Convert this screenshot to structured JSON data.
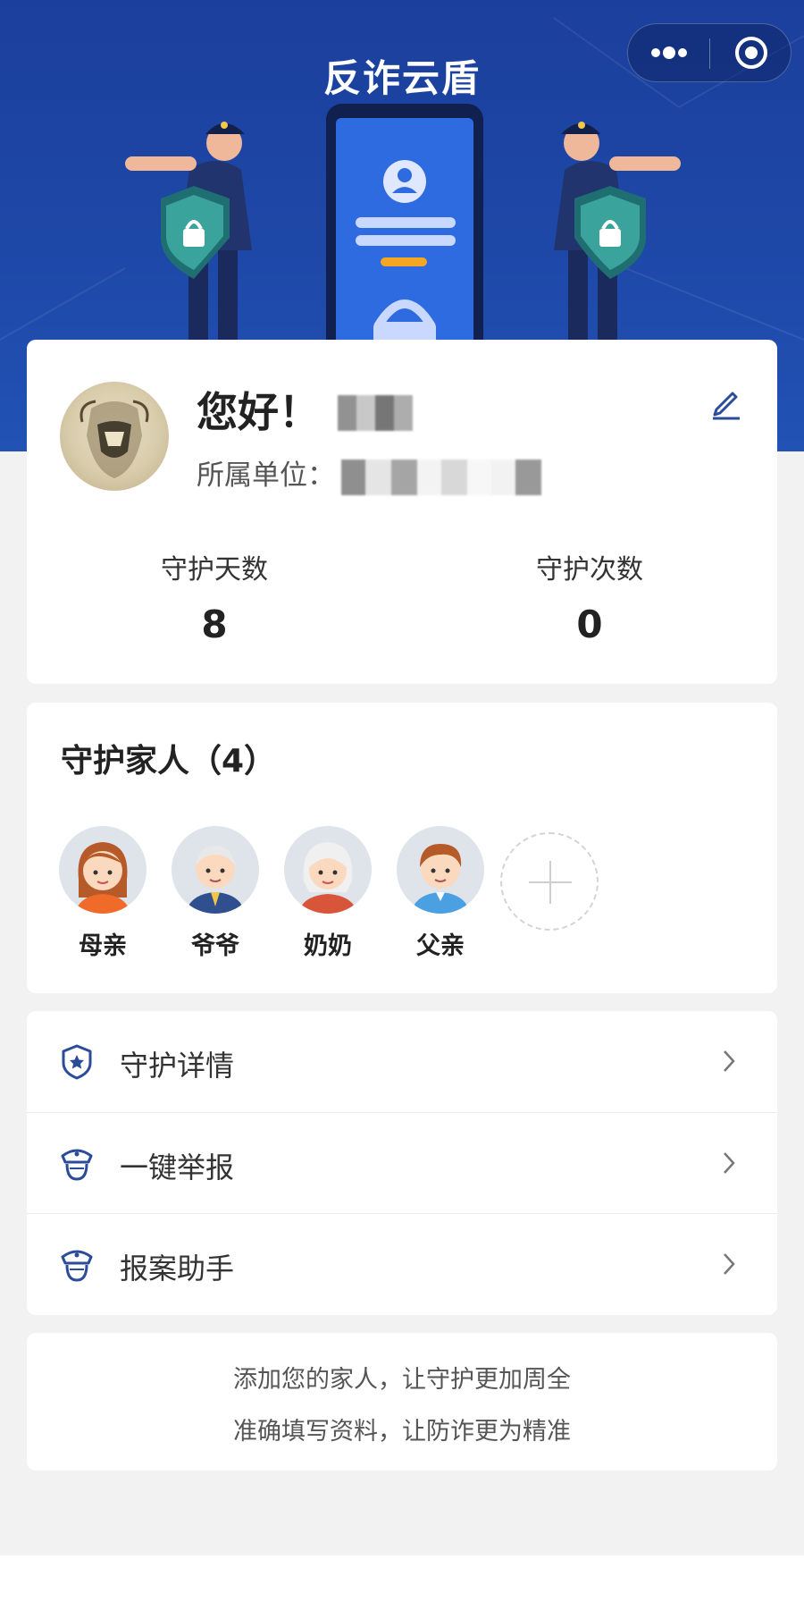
{
  "hero": {
    "title": "反诈云盾"
  },
  "profile": {
    "greeting": "您好！",
    "unit_label": "所属单位：",
    "stats": [
      {
        "label": "守护天数",
        "value": "8"
      },
      {
        "label": "守护次数",
        "value": "0"
      }
    ]
  },
  "family": {
    "title": "守护家人（4）",
    "members": [
      {
        "name": "母亲",
        "icon": "mother-avatar"
      },
      {
        "name": "爷爷",
        "icon": "grandfather-avatar"
      },
      {
        "name": "奶奶",
        "icon": "grandmother-avatar"
      },
      {
        "name": "父亲",
        "icon": "father-avatar"
      }
    ]
  },
  "menu": [
    {
      "label": "守护详情",
      "icon": "shield-star-icon"
    },
    {
      "label": "一键举报",
      "icon": "police-officer-icon"
    },
    {
      "label": "报案助手",
      "icon": "police-officer-icon"
    }
  ],
  "notice": {
    "line1": "添加您的家人，让守护更加周全",
    "line2": "准确填写资料，让防诈更为精准"
  },
  "colors": {
    "hero_blue": "#1e48a8",
    "accent": "#2b4c9a",
    "shield_teal": "#2d8a86"
  }
}
